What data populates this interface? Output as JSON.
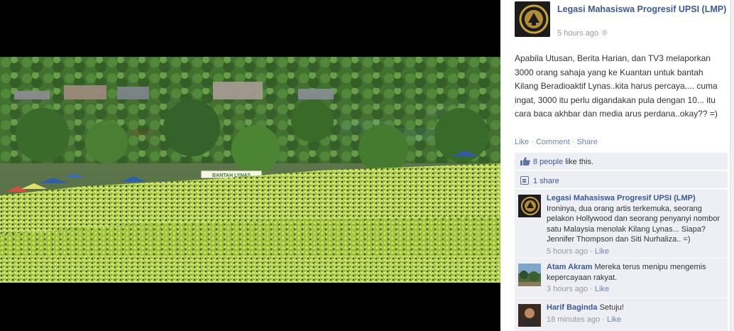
{
  "post": {
    "author": "Legasi Mahasiswa Progresif UPSI (LMP)",
    "time": "5 hours ago",
    "text": "Apabila Utusan, Berita Harian, dan TV3 melaporkan 3000 orang sahaja yang ke Kuantan untuk bantah Kilang Beradioaktif Lynas..kita harus percaya.... cuma ingat, 3000 itu perlu digandakan pula dengan 10... itu cara baca akhbar dan media arus perdana..okay?? =)",
    "actions": {
      "like": "Like",
      "comment": "Comment",
      "share": "Share",
      "separator": "·"
    },
    "likes": {
      "count": "8 people",
      "suffix": " like this."
    },
    "shares": {
      "count": "1 share"
    }
  },
  "photo": {
    "banner_text": "BANTAH LYNAS",
    "accent_colors": {
      "crowd_green": "#b7d94a",
      "tree_green": "#3f7a2a",
      "tent_blue": "#3a6fb0"
    }
  },
  "comments": [
    {
      "author": "Legasi Mahasiswa Progresif UPSI (LMP)",
      "text": "Ironinya, dua orang artis terkemuka, seorang pelakon Hollywood dan seorang penyanyi nombor satu Malaysia menolak Kilang Lynas... Siapa? Jennifer Thompson dan Siti Nurhaliza.. =)",
      "time": "5 hours ago",
      "like": "Like"
    },
    {
      "author": "Atam Akram",
      "text": "Mereka terus menipu mengemis kepercayaan rakyat.",
      "time": "3 hours ago",
      "like": "Like"
    },
    {
      "author": "Harif Baginda",
      "text": "Setuju!",
      "time": "18 minutes ago",
      "like": "Like"
    }
  ],
  "icons": {
    "globe": "globe-icon",
    "thumbs_up": "thumbs-up-icon",
    "share": "share-icon"
  }
}
